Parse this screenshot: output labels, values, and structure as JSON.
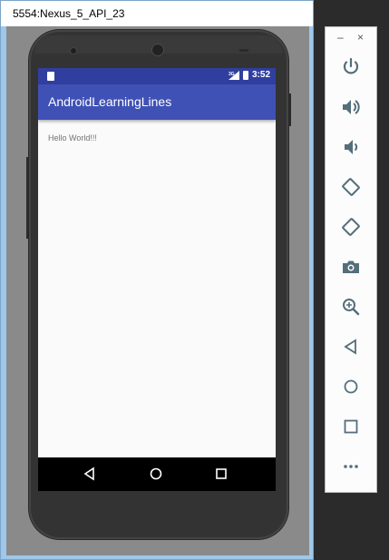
{
  "window": {
    "title": "5554:Nexus_5_API_23"
  },
  "status_bar": {
    "time": "3:52",
    "network": "3G"
  },
  "app_bar": {
    "title": "AndroidLearningLines"
  },
  "content": {
    "text": "Hello World!!!"
  },
  "toolbar": {
    "minimize": "–",
    "close": "×",
    "buttons": [
      "power-icon",
      "volume-up-icon",
      "volume-down-icon",
      "rotate-left-icon",
      "rotate-right-icon",
      "camera-icon",
      "zoom-icon",
      "back-icon",
      "home-icon",
      "overview-icon",
      "more-icon"
    ],
    "icon_color": "#546e7a"
  },
  "colors": {
    "status_bar": "#303f9f",
    "app_bar": "#3f51b5"
  }
}
